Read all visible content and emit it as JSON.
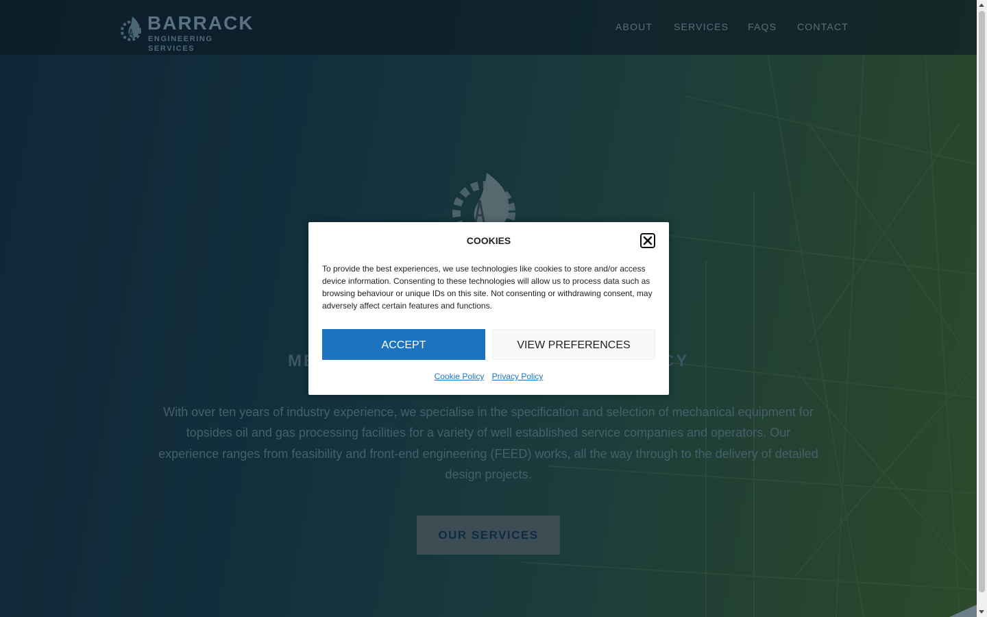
{
  "brand": {
    "name": "BARRACK",
    "tagline": "ENGINEERING SERVICES",
    "logo_icon": "flame-gear-icon"
  },
  "nav": {
    "items": [
      {
        "label": "ABOUT"
      },
      {
        "label": "SERVICES"
      },
      {
        "label": "FAQS"
      },
      {
        "label": "CONTACT"
      }
    ]
  },
  "hero": {
    "title_partial_left": "ME",
    "title_partial_right": "CY",
    "text": "With over ten years of industry experience, we specialise in the specification and selection of mechanical equipment for topsides oil and gas processing facilities for a variety of well established service companies and operators. Our experience ranges from feasibility and front-end engineering (FEED) works, all the way through to the delivery of detailed design projects.",
    "cta_label": "OUR SERVICES"
  },
  "cookie_modal": {
    "title": "COOKIES",
    "body": "To provide the best experiences, we use technologies like cookies to store and/or access device information. Consenting to these technologies will allow us to process data such as browsing behaviour or unique IDs on this site. Not consenting or withdrawing consent, may adversely affect certain features and functions.",
    "accept_label": "ACCEPT",
    "preferences_label": "VIEW PREFERENCES",
    "cookie_policy_label": "Cookie Policy",
    "privacy_policy_label": "Privacy Policy",
    "close_icon": "close-icon"
  },
  "colors": {
    "accept_button": "#1e73be",
    "link": "#1e73be",
    "overlay_dim": "#0f2636"
  }
}
